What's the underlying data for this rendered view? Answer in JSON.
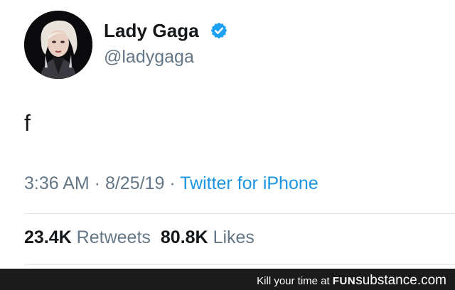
{
  "tweet": {
    "user": {
      "display_name": "Lady Gaga",
      "handle": "@ladygaga",
      "verified": true
    },
    "text": "f",
    "meta": {
      "time": "3:36 AM",
      "separator": " · ",
      "date": "8/25/19",
      "separator2": " · ",
      "source": "Twitter for iPhone"
    },
    "stats": {
      "retweets_count": "23.4K",
      "retweets_label": "Retweets",
      "likes_count": "80.8K",
      "likes_label": "Likes"
    }
  },
  "footer": {
    "tagline": "Kill your time at",
    "brand_fun": "FUN",
    "brand_substance": "substance.com"
  },
  "colors": {
    "verified_blue": "#1da1f2",
    "link_blue": "#1b95e0",
    "secondary_gray": "#657786",
    "text_dark": "#14171a",
    "footer_bg": "#1b1b1b"
  },
  "icons": {
    "verified": "verified-badge-icon",
    "avatar": "profile-photo"
  }
}
